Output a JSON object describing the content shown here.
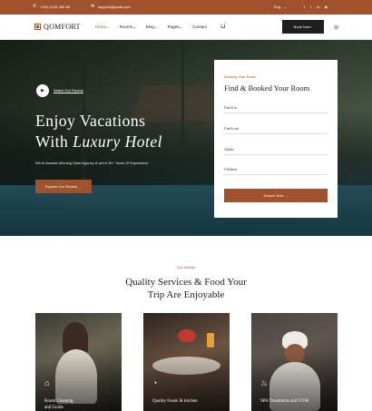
{
  "topbar": {
    "phone": "+000 (123) 456 88",
    "email": "support@gmail.com",
    "language": "Eng",
    "social_icons": [
      "facebook-icon",
      "twitter-icon",
      "instagram-icon",
      "youtube-icon"
    ],
    "social_glyphs": [
      "f",
      "t",
      "in",
      "▶"
    ]
  },
  "nav": {
    "logo_text": "QOMFORT",
    "menu": [
      {
        "label": "Home",
        "caret": "⌄"
      },
      {
        "label": "Rooms",
        "caret": "⌄"
      },
      {
        "label": "Blog",
        "caret": "⌄"
      },
      {
        "label": "Pages",
        "caret": "⌄"
      },
      {
        "label": "Contact",
        "caret": ""
      }
    ],
    "cart_count": "0",
    "book_now": "Book Now  ›"
  },
  "hero": {
    "watch": "Watch Our Rooms",
    "title_line1": "Enjoy Vacations",
    "title_line2_a": "With ",
    "title_line2_b": "Luxury Hotel",
    "subtitle": "We're Awards Winning Hotel Agency & we're 25+ Years Of Experience",
    "explore": "Explore Our Rooms  →"
  },
  "booking": {
    "tag": "Booking Your Room",
    "title": "Find & Booked Your Room",
    "fields": [
      "Check in",
      "Check out",
      "Adults",
      "Children"
    ],
    "search": "Search Now  →"
  },
  "activity": {
    "tag": "Our Activity",
    "title_line1": "Quality Services & Food Your",
    "title_line2": "Trip Are Enjoyable",
    "cards": [
      {
        "label_line1": "Room Cleaning",
        "label_line2": "and Guide",
        "icon": "cleaning-icon"
      },
      {
        "label_line1": "Quality Foods  & kitchen",
        "label_line2": "",
        "icon": "food-icon"
      },
      {
        "label_line1": "SPA Treatments and GYM",
        "label_line2": "",
        "icon": "spa-icon"
      }
    ]
  },
  "colors": {
    "accent": "#a0522d",
    "dark": "#1e1e1e"
  }
}
